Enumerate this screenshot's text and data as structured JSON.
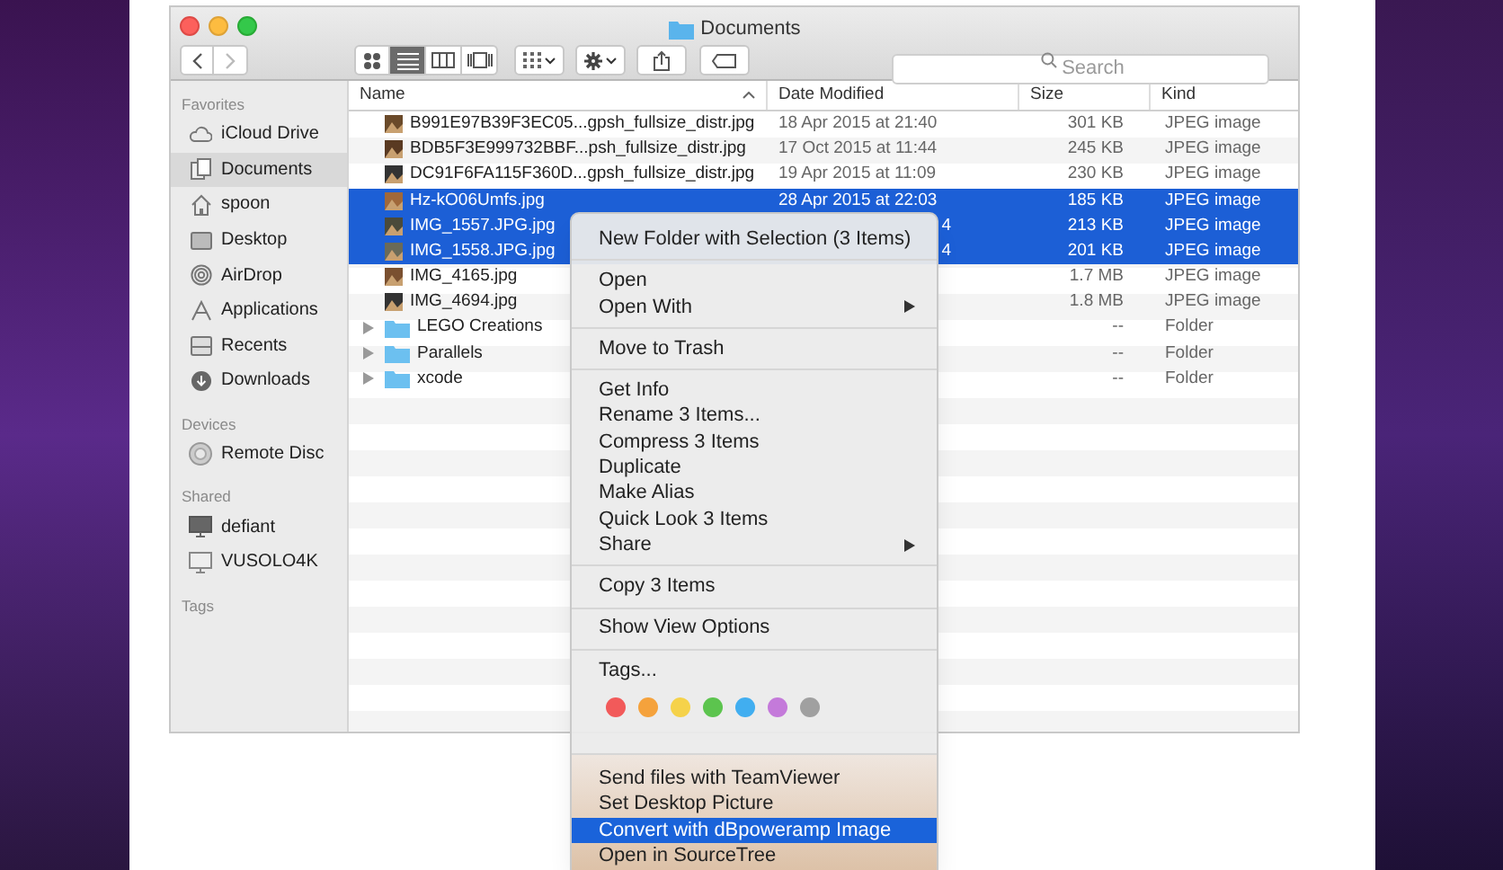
{
  "window": {
    "title": "Documents"
  },
  "toolbar": {
    "views": [
      {
        "kind": "icon",
        "selected": false
      },
      {
        "kind": "list",
        "selected": true
      },
      {
        "kind": "columns",
        "selected": false
      },
      {
        "kind": "coverflow",
        "selected": false
      }
    ],
    "search": {
      "placeholder": "Search"
    }
  },
  "sidebar": {
    "sections": [
      {
        "title": "Favorites",
        "items": [
          {
            "label": "iCloud Drive",
            "kind": "cloud",
            "selected": false
          },
          {
            "label": "Documents",
            "kind": "documents",
            "selected": true
          },
          {
            "label": "spoon",
            "kind": "home",
            "selected": false
          },
          {
            "label": "Desktop",
            "kind": "desktop",
            "selected": false
          },
          {
            "label": "AirDrop",
            "kind": "airdrop",
            "selected": false
          },
          {
            "label": "Applications",
            "kind": "apps",
            "selected": false
          },
          {
            "label": "Recents",
            "kind": "recents",
            "selected": false
          },
          {
            "label": "Downloads",
            "kind": "downloads",
            "selected": false
          }
        ]
      },
      {
        "title": "Devices",
        "items": [
          {
            "label": "Remote Disc",
            "kind": "disc",
            "selected": false
          }
        ]
      },
      {
        "title": "Shared",
        "items": [
          {
            "label": "defiant",
            "kind": "screen",
            "selected": false
          },
          {
            "label": "VUSOLO4K",
            "kind": "monitor",
            "selected": false
          }
        ]
      },
      {
        "title": "Tags"
      }
    ]
  },
  "table": {
    "columns": [
      "Name",
      "Date Modified",
      "Size",
      "Kind"
    ],
    "rows": [
      {
        "kind": "file",
        "name": "B991E97B39F3EC05...gpsh_fullsize_distr.jpg",
        "date": "18 Apr 2015 at 21:40",
        "size": "301 KB",
        "type": "JPEG image",
        "selected": false
      },
      {
        "kind": "file",
        "name": "BDB5F3E999732BBF...psh_fullsize_distr.jpg",
        "date": "17 Oct 2015 at 11:44",
        "size": "245 KB",
        "type": "JPEG image",
        "selected": false
      },
      {
        "kind": "file",
        "name": "DC91F6FA115F360D...gpsh_fullsize_distr.jpg",
        "date": "19 Apr 2015 at 11:09",
        "size": "230 KB",
        "type": "JPEG image",
        "selected": false
      },
      {
        "kind": "file",
        "name": "Hz-kO06Umfs.jpg",
        "date": "28 Apr 2015 at 22:03",
        "size": "185 KB",
        "type": "JPEG image",
        "selected": true
      },
      {
        "kind": "file",
        "name": "IMG_1557.JPG.jpg",
        "date_tail": "4",
        "size": "213 KB",
        "type": "JPEG image",
        "selected": true
      },
      {
        "kind": "file",
        "name": "IMG_1558.JPG.jpg",
        "date_tail": "4",
        "size": "201 KB",
        "type": "JPEG image",
        "selected": true
      },
      {
        "kind": "file",
        "name": "IMG_4165.jpg",
        "size": "1.7 MB",
        "type": "JPEG image",
        "selected": false
      },
      {
        "kind": "file",
        "name": "IMG_4694.jpg",
        "size": "1.8 MB",
        "type": "JPEG image",
        "selected": false
      },
      {
        "kind": "folder",
        "name": "LEGO Creations",
        "size": "--",
        "type": "Folder",
        "selected": false
      },
      {
        "kind": "folder",
        "name": "Parallels",
        "size": "--",
        "type": "Folder",
        "selected": false
      },
      {
        "kind": "folder",
        "name": "xcode",
        "size": "--",
        "type": "Folder",
        "selected": false
      }
    ]
  },
  "context_menu": {
    "sections": [
      {
        "items": [
          {
            "label": "New Folder with Selection (3 Items)",
            "submenu": false,
            "selected": false
          }
        ]
      },
      {
        "items": [
          {
            "label": "Open",
            "submenu": false,
            "selected": false
          },
          {
            "label": "Open With",
            "submenu": true,
            "selected": false
          }
        ]
      },
      {
        "items": [
          {
            "label": "Move to Trash",
            "submenu": false,
            "selected": false
          }
        ]
      },
      {
        "items": [
          {
            "label": "Get Info",
            "submenu": false,
            "selected": false
          },
          {
            "label": "Rename 3 Items...",
            "submenu": false,
            "selected": false
          },
          {
            "label": "Compress 3 Items",
            "submenu": false,
            "selected": false
          },
          {
            "label": "Duplicate",
            "submenu": false,
            "selected": false
          },
          {
            "label": "Make Alias",
            "submenu": false,
            "selected": false
          },
          {
            "label": "Quick Look 3 Items",
            "submenu": false,
            "selected": false
          },
          {
            "label": "Share",
            "submenu": true,
            "selected": false
          }
        ]
      },
      {
        "items": [
          {
            "label": "Copy 3 Items",
            "submenu": false,
            "selected": false
          }
        ]
      },
      {
        "items": [
          {
            "label": "Show View Options",
            "submenu": false,
            "selected": false
          }
        ]
      },
      {
        "items": [
          {
            "label": "Tags...",
            "submenu": false,
            "selected": false
          }
        ],
        "tags": [
          {
            "color": "#f25a5a"
          },
          {
            "color": "#f5a23c"
          },
          {
            "color": "#f5d24a"
          },
          {
            "color": "#5cc44e"
          },
          {
            "color": "#41aef0"
          },
          {
            "color": "#c47ada"
          },
          {
            "color": "#a0a0a0"
          }
        ]
      },
      {
        "items": [
          {
            "label": "Send files with TeamViewer",
            "submenu": false,
            "selected": false
          },
          {
            "label": "Set Desktop Picture",
            "submenu": false,
            "selected": false
          },
          {
            "label": "Convert with dBpoweramp Image",
            "submenu": false,
            "selected": true
          },
          {
            "label": "Open in SourceTree",
            "submenu": false,
            "selected": false
          }
        ]
      }
    ]
  }
}
